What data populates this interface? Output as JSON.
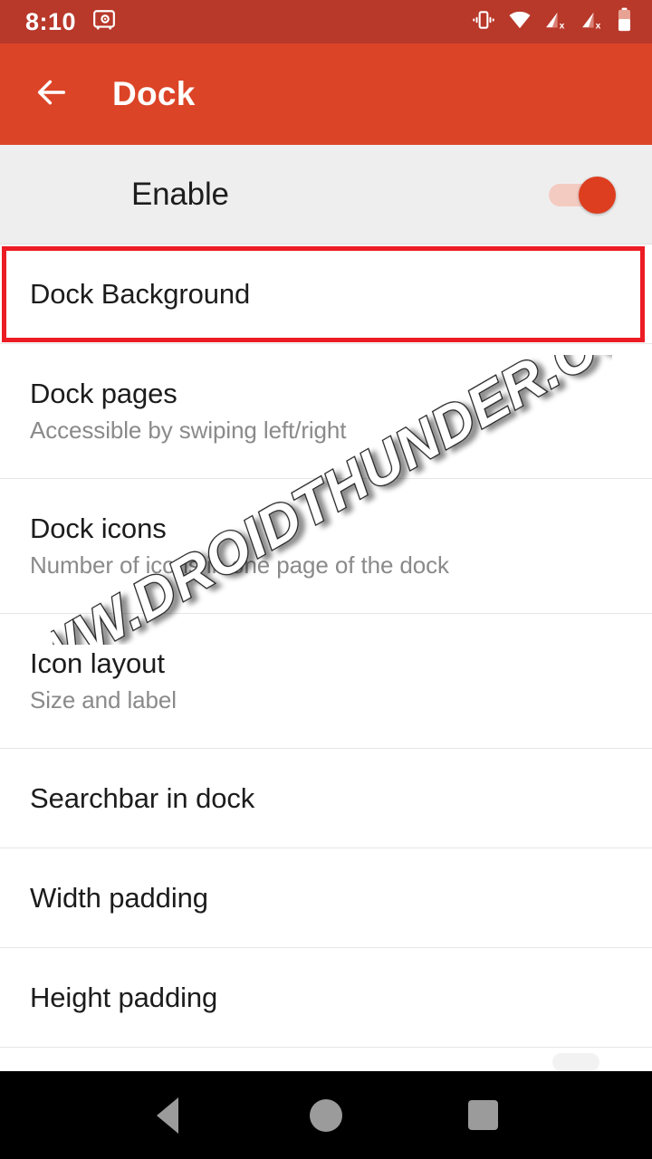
{
  "status_bar": {
    "time": "8:10",
    "background_color": "#b8382a",
    "left_icons": [
      {
        "name": "safe-vault-icon"
      }
    ],
    "right_icons": [
      {
        "name": "vibrate-icon"
      },
      {
        "name": "wifi-icon"
      },
      {
        "name": "cellular-signal-no-sim-icon-1"
      },
      {
        "name": "cellular-signal-no-sim-icon-2"
      },
      {
        "name": "battery-icon"
      }
    ]
  },
  "app_bar": {
    "title": "Dock",
    "back_icon": "arrow-left-icon",
    "background_color": "#dc4427",
    "text_color": "#ffffff"
  },
  "enable_row": {
    "label": "Enable",
    "switch_state": "on",
    "switch_track_color": "#f4cbc1",
    "switch_thumb_color": "#dd3e1f",
    "background_color": "#eeeeee"
  },
  "settings_list": {
    "items": [
      {
        "title": "Dock Background",
        "subtitle": "",
        "highlighted": true
      },
      {
        "title": "Dock pages",
        "subtitle": "Accessible by swiping left/right",
        "highlighted": false
      },
      {
        "title": "Dock icons",
        "subtitle": "Number of icons in one page of the dock",
        "highlighted": false
      },
      {
        "title": "Icon layout",
        "subtitle": "Size and label",
        "highlighted": false
      },
      {
        "title": "Searchbar in dock",
        "subtitle": "",
        "highlighted": false
      },
      {
        "title": "Width padding",
        "subtitle": "",
        "highlighted": false
      },
      {
        "title": "Height padding",
        "subtitle": "",
        "highlighted": false
      }
    ]
  },
  "annotation": {
    "target": "Dock Background",
    "color": "#ec1c24",
    "shape": "rectangle"
  },
  "watermark": {
    "text": "WWW.DROIDTHUNDER.COM",
    "style": "outlined-italic-rotated",
    "rotation_degrees": -30
  },
  "nav_bar": {
    "background_color": "#000000",
    "icon_color": "#9b9b9b",
    "buttons": [
      {
        "name": "nav-back-button",
        "icon": "triangle-back-icon"
      },
      {
        "name": "nav-home-button",
        "icon": "circle-home-icon"
      },
      {
        "name": "nav-recents-button",
        "icon": "square-recents-icon"
      }
    ]
  }
}
